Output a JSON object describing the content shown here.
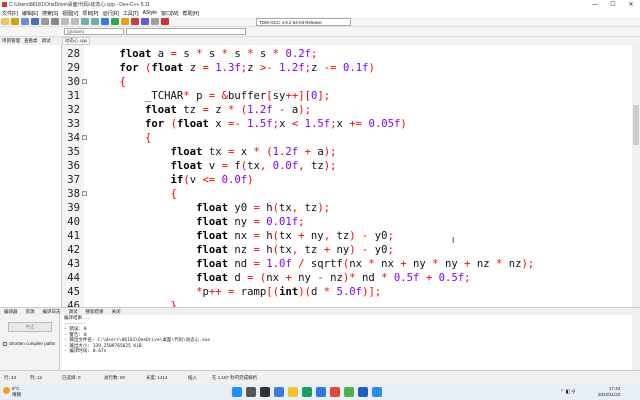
{
  "window": {
    "title": "C:\\Users\\86181\\OneDrive\\桌面\\代码\\动态心.cpp - Dev-C++ 5.11",
    "minimize": "—",
    "maximize": "☐",
    "close": "✕"
  },
  "menu": [
    "文件[F]",
    "编辑[E]",
    "搜索[S]",
    "视图[V]",
    "项目[P]",
    "运行[R]",
    "工具[T]",
    "AStyle",
    "窗口[W]",
    "帮助[H]"
  ],
  "toolbar": {
    "compiler": "TDM-GCC 4.9.2 64-bit Release",
    "globals": "(globals)"
  },
  "side_tabs": [
    "项目管理",
    "查看类",
    "调试"
  ],
  "editor_tab": "动态心.cpp",
  "code": [
    {
      "ln": "28",
      "fold": "",
      "text": "    float a = s * s * s * s * 0.2f;"
    },
    {
      "ln": "29",
      "fold": "",
      "text": "    for (float z = 1.3f;z >- 1.2f;z -= 0.1f)"
    },
    {
      "ln": "30",
      "fold": "-",
      "text": "    {"
    },
    {
      "ln": "31",
      "fold": "",
      "text": "        _TCHAR* p = &buffer[sy++][0];"
    },
    {
      "ln": "32",
      "fold": "",
      "text": "        float tz = z * (1.2f - a);"
    },
    {
      "ln": "33",
      "fold": "",
      "text": "        for (float x =- 1.5f;x < 1.5f;x += 0.05f)"
    },
    {
      "ln": "34",
      "fold": "-",
      "text": "        {"
    },
    {
      "ln": "35",
      "fold": "",
      "text": "            float tx = x * (1.2f + a);"
    },
    {
      "ln": "36",
      "fold": "",
      "text": "            float v = f(tx, 0.0f, tz);"
    },
    {
      "ln": "37",
      "fold": "",
      "text": "            if(v <= 0.0f)"
    },
    {
      "ln": "38",
      "fold": "-",
      "text": "            {"
    },
    {
      "ln": "39",
      "fold": "",
      "text": "                float y0 = h(tx, tz);"
    },
    {
      "ln": "40",
      "fold": "",
      "text": "                float ny = 0.01f;"
    },
    {
      "ln": "41",
      "fold": "",
      "text": "                float nx = h(tx + ny, tz) - y0;"
    },
    {
      "ln": "42",
      "fold": "",
      "text": "                float nz = h(tx, tz + ny) - y0;"
    },
    {
      "ln": "43",
      "fold": "",
      "text": "                float nd = 1.0f / sqrtf(nx * nx + ny * ny + nz * nz);"
    },
    {
      "ln": "44",
      "fold": "",
      "text": "                float d = (nx + ny - nz)* nd * 0.5f + 0.5f;"
    },
    {
      "ln": "45",
      "fold": "",
      "text": "                *p++ = ramp[(int)(d * 5.0f)];"
    },
    {
      "ln": "46",
      "fold": "",
      "text": "            }"
    }
  ],
  "bottom_tabs": [
    "编译器",
    "资源",
    "编译日志",
    "调试",
    "搜索结果",
    "关闭"
  ],
  "abort_label": "中止",
  "shorten_label": "Shorten compiler paths",
  "log": [
    "编译结果...",
    "--------",
    "- 错误: 0",
    "- 警告: 0",
    "- 输出文件名: C:\\Users\\86181\\OneDrive\\桌面\\代码\\动态心.exe",
    "- 输出大小: 139.2509765625 KiB",
    "- 编译时间: 0.67s"
  ],
  "status": {
    "line": "行: 43",
    "col": "列: 12",
    "selected": "已选择: 0",
    "lines": "总行数: 60",
    "length": "长度: 1414",
    "insert": "插入",
    "parse": "在 1.187 秒内完成解析"
  },
  "taskbar": {
    "temp": "9°C",
    "weather": "晴朗",
    "time": "17:44",
    "date": "2022/11/23"
  }
}
